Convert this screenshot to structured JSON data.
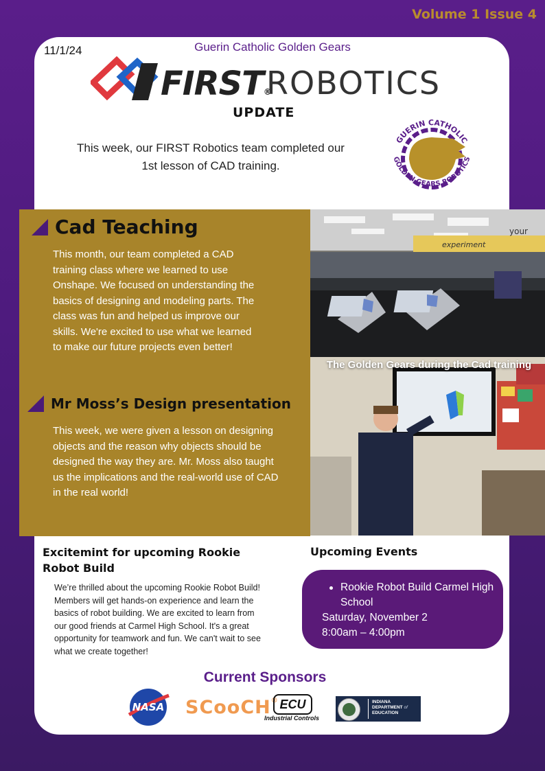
{
  "header": {
    "volume": "Volume 1 Issue 4",
    "date": "11/1/24",
    "school": "Guerin Catholic Golden Gears",
    "first_word": "FIRST",
    "first_mark": "®",
    "robotics_word": "ROBOTICS",
    "update": "UPDATE",
    "intro_line1": "This week, our FIRST Robotics team completed our",
    "intro_line2": "1st lesson of CAD training.",
    "seal_top_text": "GUERIN CATHOLIC",
    "seal_bottom_text": "GOLDEN GEARS ROBOTICS"
  },
  "cad": {
    "heading": "Cad Teaching",
    "body": "This month, our team completed a CAD training class where we learned to use Onshape. We focused on understanding the basics of designing and modeling parts. The class was fun and helped us improve our skills. We're excited to use what we learned to make our future projects even better!"
  },
  "moss": {
    "heading": "Mr Moss’s Design presentation",
    "body": "This week, we were given a lesson on designing objects and the reason why objects should be designed the way they are. Mr. Moss also taught us the implications and the real-world use of CAD in the real world!"
  },
  "photo": {
    "caption": "The Golden Gears during the Cad training",
    "banner_text": "experiment",
    "banner_text2": "your"
  },
  "rookie": {
    "heading": "Excitemint for upcoming Rookie Robot Build",
    "body": "We’re thrilled about the upcoming Rookie Robot Build! Members will get hands-on experience and learn the basics of robot building. We are excited to learn from our good friends at Carmel High School. It's a great opportunity for teamwork and fun. We can't wait to see what we create together!"
  },
  "events": {
    "heading": "Upcoming Events",
    "item": "Rookie Robot Build Carmel High School",
    "date": "Saturday, November 2",
    "time": "8:00am – 4:00pm"
  },
  "sponsors": {
    "heading": "Current Sponsors",
    "nasa": "NASA",
    "scooch": "SCooCH",
    "scooch_mark": "®",
    "ecu": "ECU",
    "ecu_sub": "Industrial Controls",
    "idoe_line1": "INDIANA",
    "idoe_line2": "DEPARTMENT",
    "idoe_of": "of",
    "idoe_line3": "EDUCATION"
  },
  "colors": {
    "purple": "#5a1e8a",
    "gold": "#a8842a",
    "volume_gold": "#b98c2e"
  }
}
